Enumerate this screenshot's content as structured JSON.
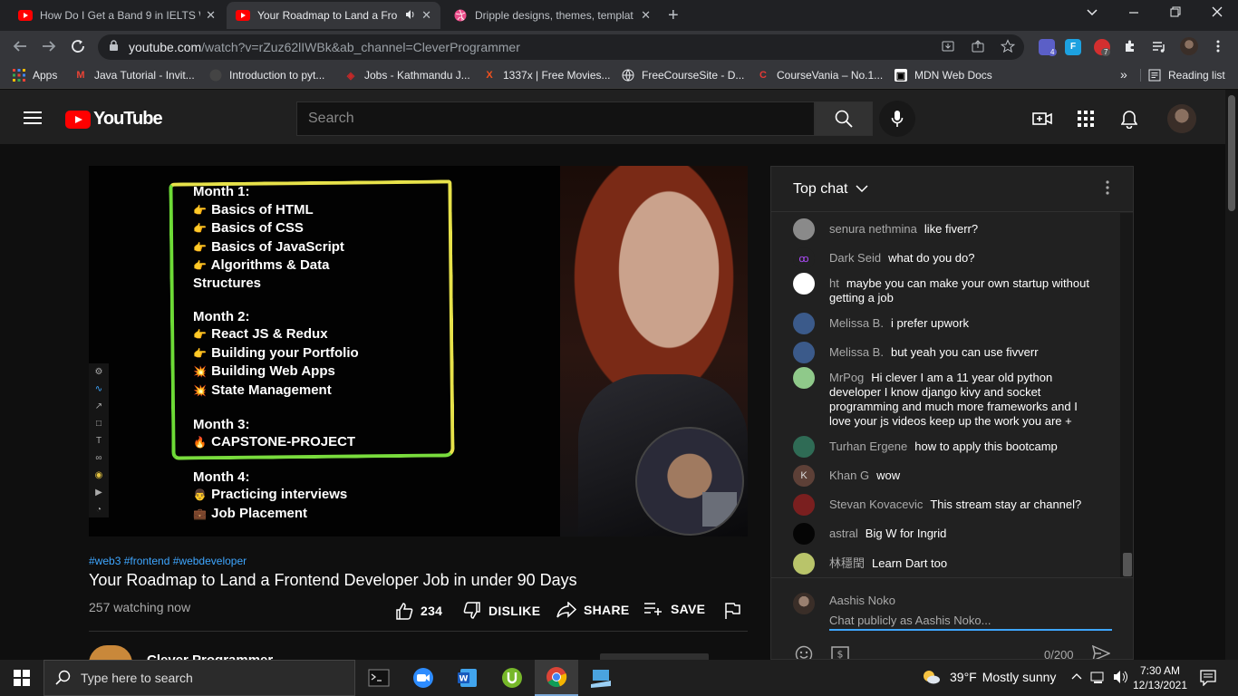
{
  "browser": {
    "tabs": [
      {
        "title": "How Do I Get a Band 9 in IELTS W",
        "close": "✕"
      },
      {
        "title": "Your Roadmap to Land a Fro",
        "close": "✕"
      },
      {
        "title": "Dripple designs, themes, templat",
        "close": "✕"
      }
    ],
    "new_tab": "+",
    "url_host": "youtube.com",
    "url_path": "/watch?v=rZuz62lIWBk&ab_channel=CleverProgrammer",
    "extension_badges": {
      "teams": "4",
      "record": "7"
    },
    "bookmarks": [
      {
        "label": "Apps"
      },
      {
        "label": "Java Tutorial - Invit..."
      },
      {
        "label": "Introduction to pyt..."
      },
      {
        "label": "Jobs - Kathmandu J..."
      },
      {
        "label": "1337x | Free Movies..."
      },
      {
        "label": "FreeCourseSite - D..."
      },
      {
        "label": "CourseVania – No.1..."
      },
      {
        "label": "MDN Web Docs"
      }
    ],
    "bookmarks_more": "»",
    "reading_list": "Reading list"
  },
  "youtube": {
    "logo_text": "YouTube",
    "search_placeholder": "Search"
  },
  "video": {
    "roadmap": [
      {
        "text": "Month 1:",
        "emoji": ""
      },
      {
        "text": "Basics of HTML",
        "emoji": "👉"
      },
      {
        "text": "Basics of CSS",
        "emoji": "👉"
      },
      {
        "text": "Basics of JavaScript",
        "emoji": "👉"
      },
      {
        "text": "Algorithms & Data",
        "emoji": "👉"
      },
      {
        "text": "Structures",
        "emoji": ""
      },
      {
        "text": "Month 2:",
        "emoji": ""
      },
      {
        "text": "React JS & Redux",
        "emoji": "👉"
      },
      {
        "text": "Building your Portfolio",
        "emoji": "👉"
      },
      {
        "text": "Building Web Apps",
        "emoji": "💥"
      },
      {
        "text": "State Management",
        "emoji": "💥"
      },
      {
        "text": "Month 3:",
        "emoji": ""
      },
      {
        "text": "CAPSTONE-PROJECT",
        "emoji": "🔥"
      },
      {
        "text": "Month 4:",
        "emoji": ""
      },
      {
        "text": "Practicing interviews",
        "emoji": "👨"
      },
      {
        "text": "Job Placement",
        "emoji": "💼"
      }
    ],
    "hashtags": "#web3 #frontend #webdeveloper",
    "title": "Your Roadmap to Land a Frontend Developer Job in under 90 Days",
    "watching": "257 watching now",
    "likes": "234",
    "dislike_label": "DISLIKE",
    "share_label": "SHARE",
    "save_label": "SAVE",
    "channel_name": "Clever Programmer"
  },
  "chat": {
    "header": "Top chat",
    "messages": [
      {
        "author": "senura nethmina",
        "text": "like fiverr?",
        "avatar_color": "#8a8a8a",
        "initial": ""
      },
      {
        "author": "Dark Seid",
        "text": "what do you do?",
        "avatar_color": "#212121",
        "initial": "ꝏ"
      },
      {
        "author": "ht",
        "text": "maybe you can make your own startup without getting a job",
        "avatar_color": "#ffffff",
        "initial": ""
      },
      {
        "author": "Melissa B.",
        "text": "i prefer upwork",
        "avatar_color": "#3b5a8a",
        "initial": ""
      },
      {
        "author": "Melissa B.",
        "text": "but yeah you can use fivverr",
        "avatar_color": "#3b5a8a",
        "initial": ""
      },
      {
        "author": "MrPog",
        "text": "Hi clever I am a 11 year old python developer I know django kivy and socket programming and much more frameworks and I love your js videos keep up the work you are +",
        "avatar_color": "#8fc98a",
        "initial": ""
      },
      {
        "author": "Turhan Ergene",
        "text": "how to apply this bootcamp",
        "avatar_color": "#2f6b55",
        "initial": ""
      },
      {
        "author": "Khan G",
        "text": "wow",
        "avatar_color": "#5d4037",
        "initial": "K"
      },
      {
        "author": "Stevan Kovacevic",
        "text": "This stream stay ar channel?",
        "avatar_color": "#7a1f1f",
        "initial": ""
      },
      {
        "author": "astral",
        "text": "Big W for Ingrid",
        "avatar_color": "#050505",
        "initial": ""
      },
      {
        "author": "林穩閏",
        "text": "Learn Dart too",
        "avatar_color": "#b9c46a",
        "initial": ""
      }
    ],
    "current_user": "Aashis Noko",
    "input_placeholder": "Chat publicly as Aashis Noko...",
    "char_count": "0/200"
  },
  "taskbar": {
    "search_placeholder": "Type here to search",
    "weather_temp": "39°F",
    "weather_desc": "Mostly sunny",
    "time": "7:30 AM",
    "date": "12/13/2021"
  },
  "colors": {
    "yt_red": "#ff0000",
    "link_blue": "#3ea6ff",
    "box_yellow": "#e7e24a",
    "box_green": "#6ddb36"
  }
}
